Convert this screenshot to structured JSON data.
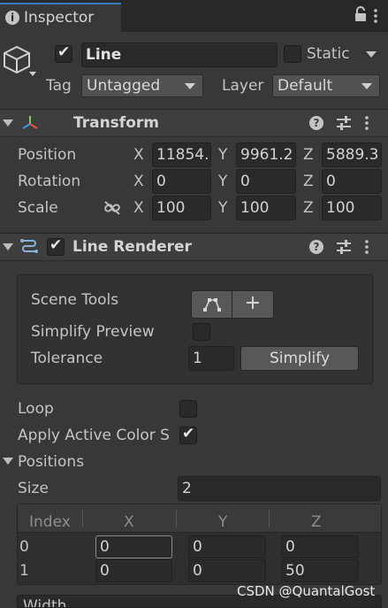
{
  "tab": {
    "title": "Inspector"
  },
  "object": {
    "name": "Line",
    "active": true,
    "static_label": "Static",
    "tag_label": "Tag",
    "tag_value": "Untagged",
    "layer_label": "Layer",
    "layer_value": "Default"
  },
  "transform": {
    "title": "Transform",
    "position_label": "Position",
    "rotation_label": "Rotation",
    "scale_label": "Scale",
    "axis_x": "X",
    "axis_y": "Y",
    "axis_z": "Z",
    "position": {
      "x": "11854.",
      "y": "9961.2",
      "z": "5889.3"
    },
    "rotation": {
      "x": "0",
      "y": "0",
      "z": "0"
    },
    "scale": {
      "x": "100",
      "y": "100",
      "z": "100"
    }
  },
  "line_renderer": {
    "title": "Line Renderer",
    "enabled": true,
    "scene_tools_label": "Scene Tools",
    "simplify_preview_label": "Simplify Preview",
    "tolerance_label": "Tolerance",
    "tolerance_value": "1",
    "simplify_button": "Simplify",
    "add_button": "+",
    "loop_label": "Loop",
    "loop_checked": false,
    "apply_color_label": "Apply Active Color S",
    "apply_color_checked": true,
    "positions_label": "Positions",
    "size_label": "Size",
    "size_value": "2",
    "table_headers": [
      "Index",
      "X",
      "Y",
      "Z"
    ],
    "rows": [
      {
        "index": "0",
        "x": "0",
        "y": "0",
        "z": "0"
      },
      {
        "index": "1",
        "x": "0",
        "y": "0",
        "z": "50"
      }
    ],
    "width_label": "Width"
  },
  "watermark": "CSDN @QuantalGost",
  "colors": {
    "background": "#383838",
    "field": "#2a2a2a",
    "header": "#3e3e3e",
    "text": "#c4c4c4"
  }
}
